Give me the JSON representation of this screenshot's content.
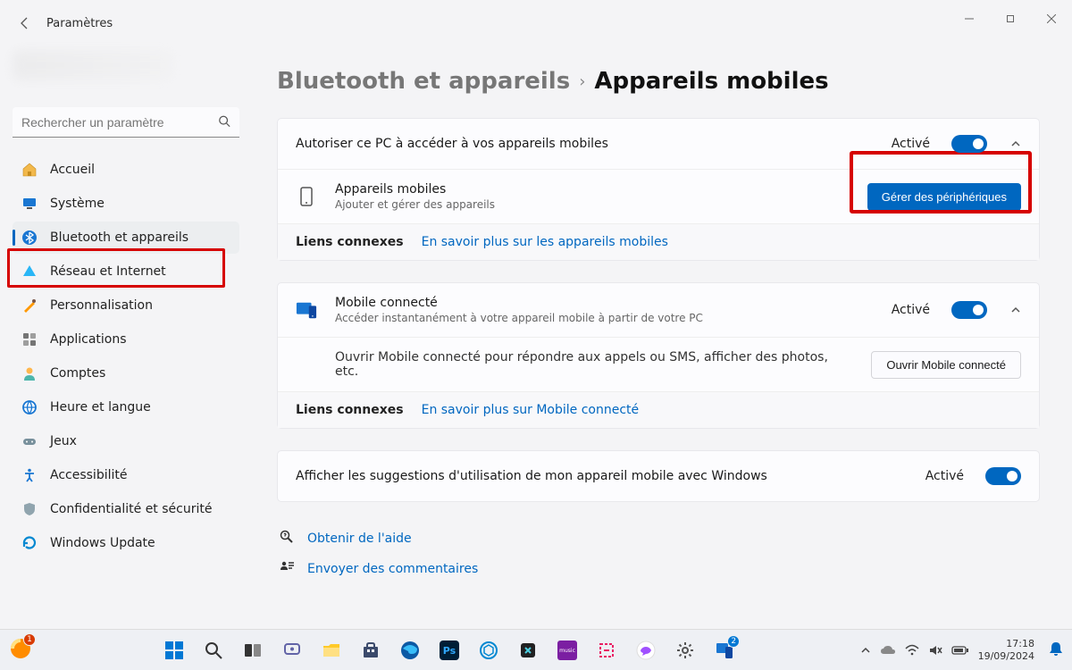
{
  "window": {
    "title": "Paramètres"
  },
  "search": {
    "placeholder": "Rechercher un paramètre"
  },
  "sidebar": {
    "items": [
      {
        "label": "Accueil",
        "icon": "home"
      },
      {
        "label": "Système",
        "icon": "system"
      },
      {
        "label": "Bluetooth et appareils",
        "icon": "bluetooth",
        "active": true
      },
      {
        "label": "Réseau et Internet",
        "icon": "wifi"
      },
      {
        "label": "Personnalisation",
        "icon": "paint"
      },
      {
        "label": "Applications",
        "icon": "apps"
      },
      {
        "label": "Comptes",
        "icon": "person"
      },
      {
        "label": "Heure et langue",
        "icon": "globe"
      },
      {
        "label": "Jeux",
        "icon": "gamepad"
      },
      {
        "label": "Accessibilité",
        "icon": "accessibility"
      },
      {
        "label": "Confidentialité et sécurité",
        "icon": "shield"
      },
      {
        "label": "Windows Update",
        "icon": "update"
      }
    ]
  },
  "breadcrumb": {
    "parent": "Bluetooth et appareils",
    "current": "Appareils mobiles"
  },
  "allow": {
    "title": "Autoriser ce PC à accéder à vos appareils mobiles",
    "status": "Activé",
    "devices_title": "Appareils mobiles",
    "devices_sub": "Ajouter et gérer des appareils",
    "manage_btn": "Gérer des périphériques",
    "links_label": "Liens connexes",
    "link": "En savoir plus sur les appareils mobiles"
  },
  "phone_link": {
    "title": "Mobile connecté",
    "sub": "Accéder instantanément à votre appareil mobile à partir de votre PC",
    "status": "Activé",
    "open_desc": "Ouvrir Mobile connecté pour répondre aux appels ou SMS, afficher des photos, etc.",
    "open_btn": "Ouvrir Mobile connecté",
    "links_label": "Liens connexes",
    "link": "En savoir plus sur Mobile connecté"
  },
  "suggestions": {
    "title": "Afficher les suggestions d'utilisation de mon appareil mobile avec Windows",
    "status": "Activé"
  },
  "help": {
    "get_help": "Obtenir de l'aide",
    "feedback": "Envoyer des commentaires"
  },
  "taskbar": {
    "time": "17:18",
    "date": "19/09/2024",
    "badge_count_left": "1",
    "badge_count_right": "2"
  }
}
